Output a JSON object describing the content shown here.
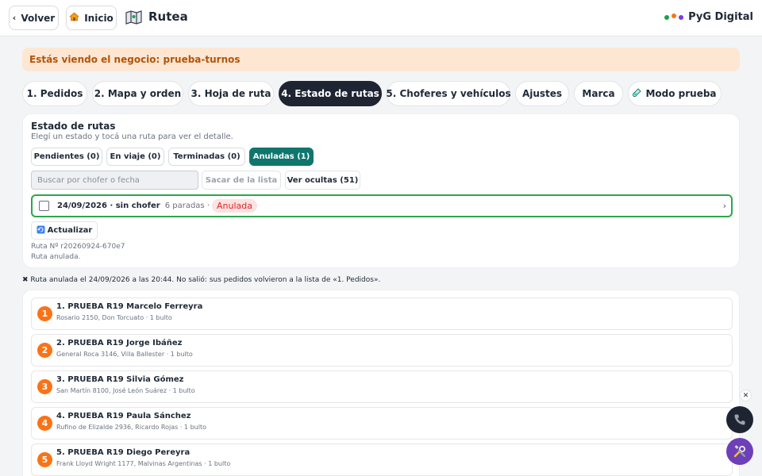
{
  "header": {
    "back_label": "Volver",
    "home_label": "Inicio",
    "app_title": "Rutea",
    "org_name": "PyG Digital",
    "org_dot_colors": [
      "#16a34a",
      "#f97316",
      "#7c3aed"
    ]
  },
  "notice": {
    "text": "Estás viendo el negocio: prueba-turnos"
  },
  "tabs": [
    {
      "label": "1. Pedidos",
      "active": false
    },
    {
      "label": "2. Mapa y orden",
      "active": false
    },
    {
      "label": "3. Hoja de ruta",
      "active": false
    },
    {
      "label": "4. Estado de rutas",
      "active": true
    },
    {
      "label": "5. Choferes y vehículos",
      "active": false
    },
    {
      "label": "Ajustes",
      "active": false
    },
    {
      "label": "Marca",
      "active": false
    },
    {
      "label": "Modo prueba",
      "icon": "test-tube-icon",
      "active": false
    }
  ],
  "status": {
    "title": "Estado de rutas",
    "subtitle": "Elegí un estado y tocá una ruta para ver el detalle.",
    "filters": [
      {
        "label": "Pendientes (0)",
        "active": false
      },
      {
        "label": "En viaje (0)",
        "active": false
      },
      {
        "label": "Terminadas (0)",
        "active": false
      },
      {
        "label": "Anuladas (1)",
        "active": true
      }
    ],
    "search_placeholder": "Buscar por chofer o fecha",
    "remove_label": "Sacar de la lista",
    "hidden_label": "Ver ocultas (51)",
    "route": {
      "date_driver": "24/09/2026 · sin chofer",
      "stops": "6 paradas ·",
      "badge": "Anulada",
      "badge_color": "#dc2626"
    },
    "refresh_label": "Actualizar",
    "route_number": "Ruta Nº r20260924-670e7",
    "route_state": "Ruta anulada."
  },
  "cancel_note": "✖ Ruta anulada el 24/09/2026 a las 20:44. No salió: sus pedidos volvieron a la lista de «1. Pedidos».",
  "stops": [
    {
      "num": "1",
      "name": "1. PRUEBA R19 Marcelo Ferreyra",
      "detail": "Rosario 2150, Don Torcuato · 1 bulto"
    },
    {
      "num": "2",
      "name": "2. PRUEBA R19 Jorge Ibáñez",
      "detail": "General Roca 3146, Villa Ballester · 1 bulto"
    },
    {
      "num": "3",
      "name": "3. PRUEBA R19 Silvia Gómez",
      "detail": "San Martín 8100, José León Suárez · 1 bulto"
    },
    {
      "num": "4",
      "name": "4. PRUEBA R19 Paula Sánchez",
      "detail": "Rufino de Elizalde 2936, Ricardo Rojas · 1 bulto"
    },
    {
      "num": "5",
      "name": "5. PRUEBA R19 Diego Pereyra",
      "detail": "Frank Lloyd Wright 1177, Malvinas Argentinas · 1 bulto"
    }
  ],
  "colors": {
    "accent_dark": "#1f2433",
    "filter_active": "#0f766e",
    "route_border": "#2aa84a",
    "stop_badge": "#f97316",
    "notice_bg": "#fde7d2",
    "notice_text": "#b45309"
  }
}
